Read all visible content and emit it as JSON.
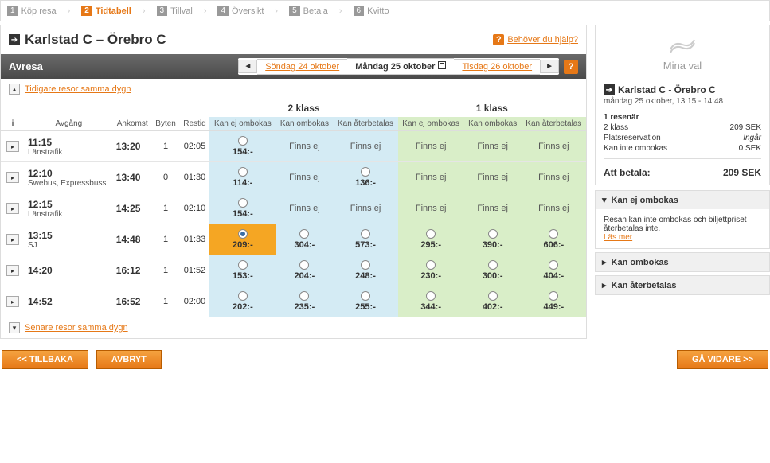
{
  "steps": [
    {
      "n": "1",
      "l": "Köp resa"
    },
    {
      "n": "2",
      "l": "Tidtabell"
    },
    {
      "n": "3",
      "l": "Tillval"
    },
    {
      "n": "4",
      "l": "Översikt"
    },
    {
      "n": "5",
      "l": "Betala"
    },
    {
      "n": "6",
      "l": "Kvitto"
    }
  ],
  "route": "Karlstad C – Örebro C",
  "help": "Behöver du hjälp?",
  "bar_title": "Avresa",
  "prev_date": "Söndag 24 oktober",
  "cur_date": "Måndag 25 oktober",
  "next_date": "Tisdag 26 oktober",
  "earlier": "Tidigare resor samma dygn",
  "later": "Senare resor samma dygn",
  "h_avgang": "Avgång",
  "h_ankomst": "Ankomst",
  "h_byten": "Byten",
  "h_restid": "Restid",
  "h_2klass": "2 klass",
  "h_1klass": "1 klass",
  "h_kej": "Kan ej ombokas",
  "h_kom": "Kan ombokas",
  "h_kat": "Kan återbetalas",
  "ne": "Finns ej",
  "rows": [
    {
      "dep": "11:15",
      "arr": "13:20",
      "op": "Länstrafik",
      "ch": "1",
      "dur": "02:05",
      "p": [
        "154:-",
        "",
        "",
        "",
        "",
        ""
      ]
    },
    {
      "dep": "12:10",
      "arr": "13:40",
      "op": "Swebus, Expressbuss",
      "ch": "0",
      "dur": "01:30",
      "p": [
        "114:-",
        "",
        "136:-",
        "",
        "",
        ""
      ]
    },
    {
      "dep": "12:15",
      "arr": "14:25",
      "op": "Länstrafik",
      "ch": "1",
      "dur": "02:10",
      "p": [
        "154:-",
        "",
        "",
        "",
        "",
        ""
      ]
    },
    {
      "dep": "13:15",
      "arr": "14:48",
      "op": "SJ",
      "ch": "1",
      "dur": "01:33",
      "p": [
        "209:-",
        "304:-",
        "573:-",
        "295:-",
        "390:-",
        "606:-"
      ],
      "sel": 0
    },
    {
      "dep": "14:20",
      "arr": "16:12",
      "op": "",
      "ch": "1",
      "dur": "01:52",
      "p": [
        "153:-",
        "204:-",
        "248:-",
        "230:-",
        "300:-",
        "404:-"
      ]
    },
    {
      "dep": "14:52",
      "arr": "16:52",
      "op": "",
      "ch": "1",
      "dur": "02:00",
      "p": [
        "202:-",
        "235:-",
        "255:-",
        "344:-",
        "402:-",
        "449:-"
      ]
    }
  ],
  "mina_val": "Mina val",
  "sum_route": "Karlstad C - Örebro C",
  "sum_date": "måndag 25 oktober, 13:15 - 14:48",
  "sum_res": "1 resenär",
  "sum_lines": [
    {
      "l": "2 klass",
      "r": "209 SEK"
    },
    {
      "l": "Platsreservation",
      "r": "Ingår",
      "ital": true
    },
    {
      "l": "Kan inte ombokas",
      "r": "0 SEK"
    }
  ],
  "tot_l": "Att betala:",
  "tot_r": "209 SEK",
  "acc1_t": "Kan ej ombokas",
  "acc1_b": "Resan kan inte ombokas och biljettpriset återbetalas inte.",
  "acc1_link": "Läs mer",
  "acc2_t": "Kan ombokas",
  "acc3_t": "Kan återbetalas",
  "btn_back": "<< TILLBAKA",
  "btn_cancel": "AVBRYT",
  "btn_next": "GÅ VIDARE >>"
}
